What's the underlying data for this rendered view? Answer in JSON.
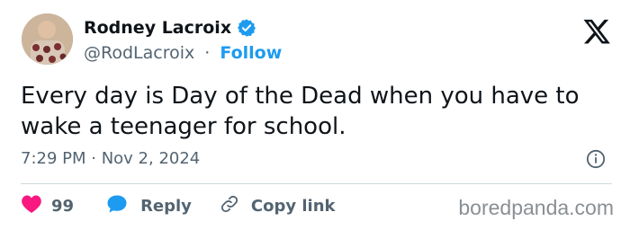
{
  "author": {
    "display_name": "Rodney Lacroix",
    "handle": "@RodLacroix",
    "separator": "·",
    "follow_label": "Follow",
    "verified_icon": "verified-badge-icon",
    "verified_color": "#1d9bf0"
  },
  "tweet": {
    "text": "Every day is Day of the Dead when you have to wake a teenager for school.",
    "timestamp": "7:29 PM · Nov 2, 2024"
  },
  "actions": {
    "like_count": "99",
    "like_color": "#f91880",
    "reply_label": "Reply",
    "reply_color": "#1d9bf0",
    "copy_label": "Copy link"
  },
  "watermark": "boredpanda.com"
}
